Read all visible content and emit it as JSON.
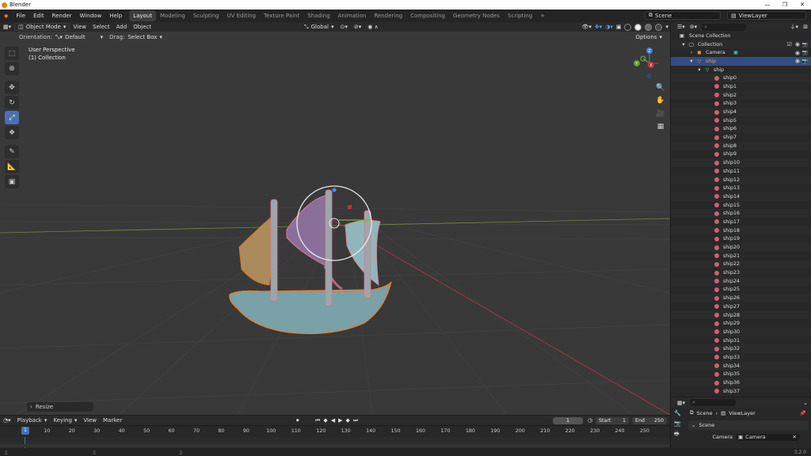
{
  "window": {
    "title": "Blender",
    "controls": [
      "—",
      "❐",
      "✕"
    ]
  },
  "menubar": {
    "menus": [
      "File",
      "Edit",
      "Render",
      "Window",
      "Help"
    ],
    "workspaces": [
      "Layout",
      "Modeling",
      "Sculpting",
      "UV Editing",
      "Texture Paint",
      "Shading",
      "Animation",
      "Rendering",
      "Compositing",
      "Geometry Nodes",
      "Scripting"
    ],
    "active_workspace": "Layout",
    "add_tab": "+",
    "scene": "Scene",
    "view_layer": "ViewLayer"
  },
  "viewport_header": {
    "mode": "Object Mode",
    "menus": [
      "View",
      "Select",
      "Add",
      "Object"
    ],
    "transform_orientation": "Global"
  },
  "tool_header": {
    "orientation_label": "Orientation:",
    "orientation_value": "Default",
    "drag_label": "Drag:",
    "drag_value": "Select Box",
    "options": "Options"
  },
  "viewport": {
    "perspective": "User Perspective",
    "collection": "(1) Collection",
    "redo_panel": "Resize",
    "colors": {
      "background": "#393939",
      "selection_outline": "#f07a1a",
      "active_tool": "#4772b3"
    }
  },
  "gizmo": {
    "z": "Z",
    "x": "X",
    "y": "Y"
  },
  "outliner": {
    "root": "Scene Collection",
    "collection": "Collection",
    "camera": "Camera",
    "object": "ship",
    "mesh": "ship",
    "children": [
      "ship0",
      "ship1",
      "ship2",
      "ship3",
      "ship4",
      "ship5",
      "ship6",
      "ship7",
      "ship8",
      "ship9",
      "ship10",
      "ship11",
      "ship12",
      "ship13",
      "ship14",
      "ship15",
      "ship16",
      "ship17",
      "ship18",
      "ship19",
      "ship20",
      "ship21",
      "ship22",
      "ship23",
      "ship24",
      "ship25",
      "ship26",
      "ship27",
      "ship28",
      "ship29",
      "ship30",
      "ship31",
      "ship32",
      "ship33",
      "ship34",
      "ship35",
      "ship36",
      "ship37"
    ]
  },
  "properties": {
    "crumb_scene": "Scene",
    "crumb_layer": "ViewLayer",
    "panel": "Scene",
    "camera_label": "Camera",
    "camera_value": "Camera"
  },
  "timeline": {
    "menus": [
      "Playback",
      "Keying",
      "View",
      "Marker"
    ],
    "current_frame": "1",
    "start_label": "Start",
    "start": "1",
    "end_label": "End",
    "end": "250",
    "playhead": "1",
    "ticks": [
      "10",
      "20",
      "30",
      "40",
      "50",
      "60",
      "70",
      "80",
      "90",
      "100",
      "110",
      "120",
      "130",
      "140",
      "150",
      "160",
      "170",
      "180",
      "190",
      "200",
      "210",
      "220",
      "230",
      "240",
      "250"
    ]
  },
  "statusbar": {
    "version": "3.2.0"
  }
}
